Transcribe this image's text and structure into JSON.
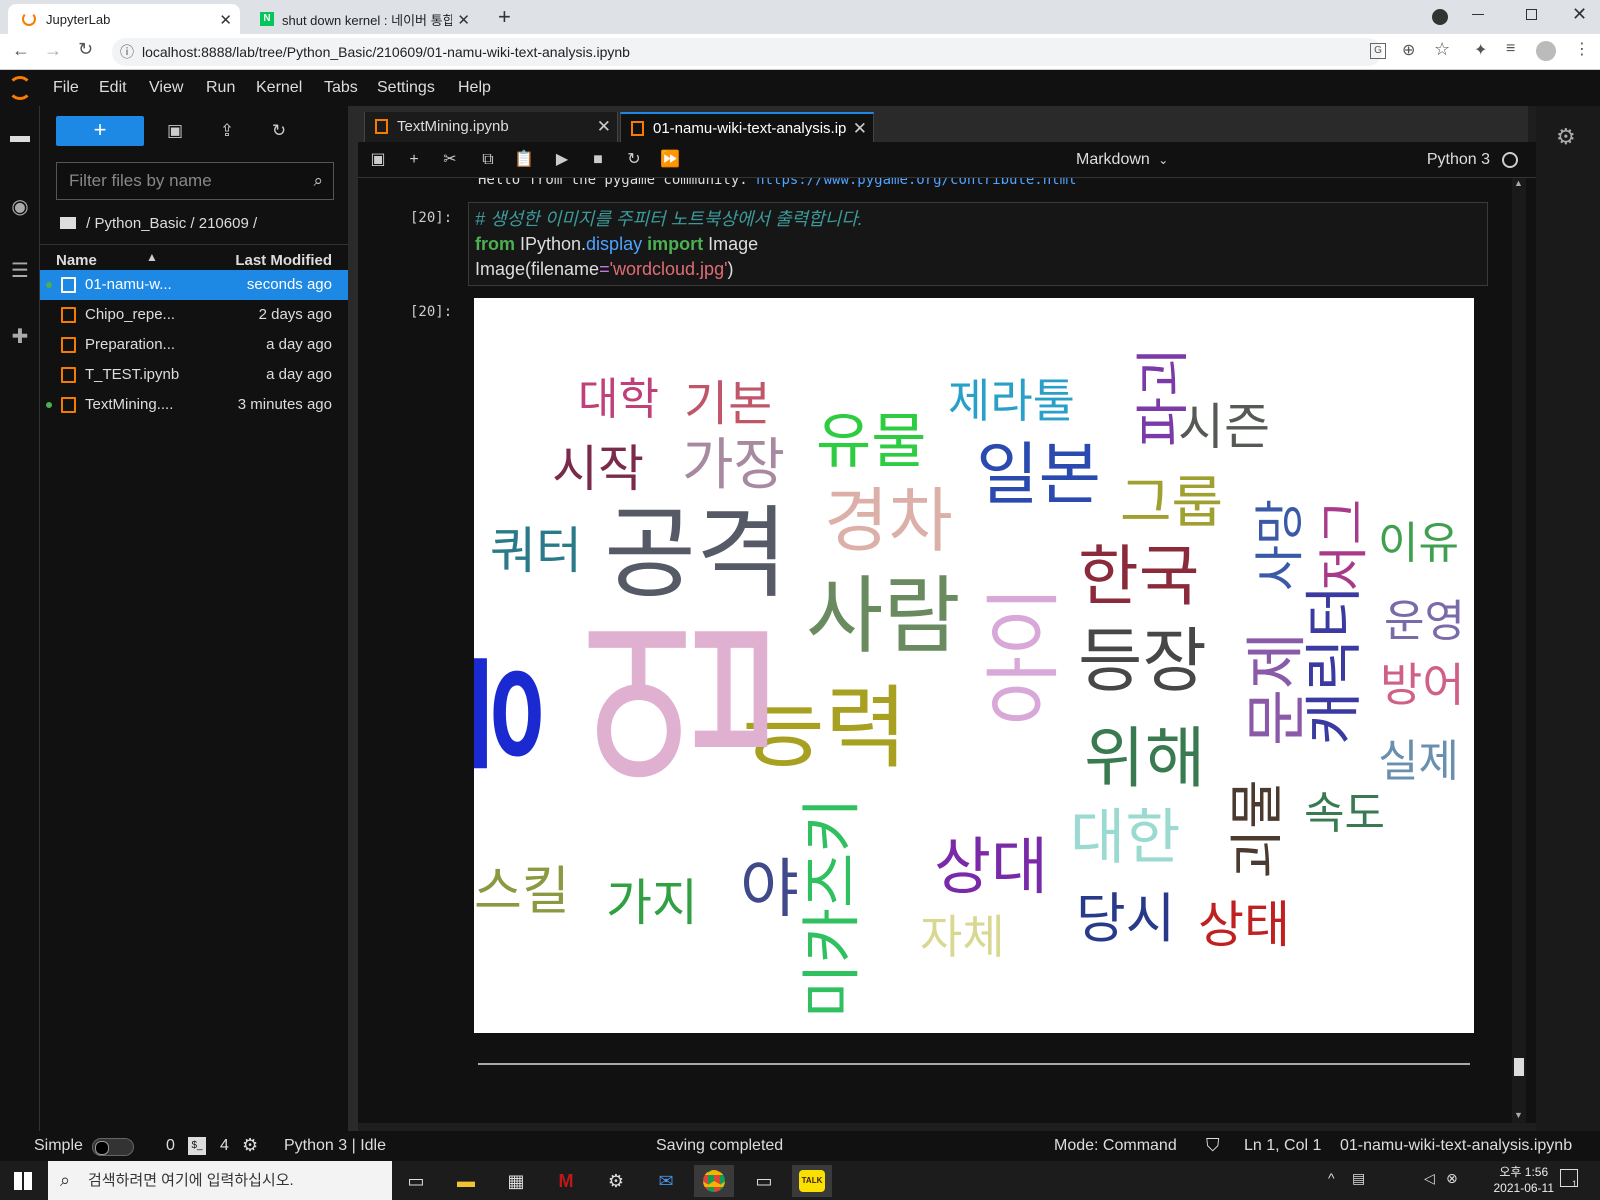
{
  "browser": {
    "tabs": [
      {
        "title": "JupyterLab"
      },
      {
        "title": "shut down kernel : 네이버 통합"
      }
    ],
    "new_tab": "+",
    "url": "localhost:8888/lab/tree/Python_Basic/210609/01-namu-wiki-text-analysis.ipynb"
  },
  "menubar": {
    "items": [
      "File",
      "Edit",
      "View",
      "Run",
      "Kernel",
      "Tabs",
      "Settings",
      "Help"
    ]
  },
  "filebrowser": {
    "new_label": "+",
    "filter_placeholder": "Filter files by name",
    "breadcrumb": "/ Python_Basic / 210609 /",
    "col_name": "Name",
    "col_modified": "Last Modified",
    "files": [
      {
        "name": "01-namu-w...",
        "modified": "seconds ago",
        "running": true,
        "selected": true
      },
      {
        "name": "Chipo_repe...",
        "modified": "2 days ago",
        "running": false,
        "selected": false
      },
      {
        "name": "Preparation...",
        "modified": "a day ago",
        "running": false,
        "selected": false
      },
      {
        "name": "T_TEST.ipynb",
        "modified": "a day ago",
        "running": false,
        "selected": false
      },
      {
        "name": "TextMining....",
        "modified": "3 minutes ago",
        "running": true,
        "selected": false
      }
    ]
  },
  "doc_tabs": [
    {
      "title": "TextMining.ipynb"
    },
    {
      "title": "01-namu-wiki-text-analysis.ip"
    }
  ],
  "toolbar": {
    "cell_type": "Markdown",
    "kernel": "Python 3"
  },
  "notebook": {
    "prev_output_text": "Hello from the pygame community. ",
    "prev_output_link": "https://www.pygame.org/contribute.html",
    "in_prompt": "[20]:",
    "out_prompt": "[20]:",
    "code": {
      "comment": "# 생성한 이미지를 주피터 노트북상에서 출력합니다.",
      "kw_from": "from",
      "mod": " IPython.",
      "attr": "display",
      "kw_import": "import",
      "name": " Image",
      "call": "Image(filename",
      "eq": "=",
      "str": "'wordcloud.jpg'",
      "close": ")"
    }
  },
  "wordcloud": {
    "words": [
      {
        "text": "대학",
        "color": "#c0407a"
      },
      {
        "text": "기본",
        "color": "#c0566a"
      },
      {
        "text": "제라툴",
        "color": "#2aa0c8"
      },
      {
        "text": "유물",
        "color": "#2ecc40"
      },
      {
        "text": "시즌",
        "color": "#555a55"
      },
      {
        "text": "시작",
        "color": "#7a2a4a"
      },
      {
        "text": "가장",
        "color": "#a88aa0"
      },
      {
        "text": "일본",
        "color": "#2a4ab0"
      },
      {
        "text": "그룹",
        "color": "#a0a030"
      },
      {
        "text": "경차",
        "color": "#dcb0a8"
      },
      {
        "text": "쿼터",
        "color": "#2a7a8a"
      },
      {
        "text": "공격",
        "color": "#555a66"
      },
      {
        "text": "이유",
        "color": "#40a050"
      },
      {
        "text": "한국",
        "color": "#8a2a3a"
      },
      {
        "text": "사람",
        "color": "#6a8a60"
      },
      {
        "text": "운영",
        "color": "#7a6aa8"
      },
      {
        "text": "등장",
        "color": "#474747"
      },
      {
        "text": "방어",
        "color": "#d06088"
      },
      {
        "text": "능력",
        "color": "#a8a020"
      },
      {
        "text": "위해",
        "color": "#3a7a50"
      },
      {
        "text": "실제",
        "color": "#6a90b0"
      },
      {
        "text": "속도",
        "color": "#3a7a50"
      },
      {
        "text": "대한",
        "color": "#9adad0"
      },
      {
        "text": "상대",
        "color": "#7a2aa8"
      },
      {
        "text": "스킬",
        "color": "#8a9a40"
      },
      {
        "text": "가지",
        "color": "#30a040"
      },
      {
        "text": "야",
        "color": "#404a8a"
      },
      {
        "text": "당시",
        "color": "#2a3a8a"
      },
      {
        "text": "상태",
        "color": "#c02020"
      },
      {
        "text": "자체",
        "color": "#d8d890"
      },
      {
        "text": "문제",
        "color": "#8a5aa8"
      },
      {
        "text": "괴물",
        "color": "#4a3a30"
      },
      {
        "text": "캐릭터",
        "color": "#3a3aa0"
      },
      {
        "text": "사망",
        "color": "#3a5aa8"
      },
      {
        "text": "저그",
        "color": "#a83a8a"
      },
      {
        "text": "파괴",
        "color": "#7a3aa8"
      },
      {
        "text": "아이",
        "color": "#d8a8d8"
      },
      {
        "text": "공",
        "color": "#1a2ad0"
      },
      {
        "text": "업",
        "color": "#e0b0d0"
      },
      {
        "text": "미카즈키",
        "color": "#30c060"
      }
    ]
  },
  "statusbar": {
    "simple": "Simple",
    "terminals": "0",
    "kernels": "4",
    "kernel_status": "Python 3 | Idle",
    "message": "Saving completed",
    "mode": "Mode: Command",
    "position": "Ln 1, Col 1",
    "filename": "01-namu-wiki-text-analysis.ipynb"
  },
  "taskbar": {
    "search_placeholder": "검색하려면 여기에 입력하십시오.",
    "time": "오후 1:56",
    "date": "2021-06-11",
    "notification_count": "1"
  }
}
